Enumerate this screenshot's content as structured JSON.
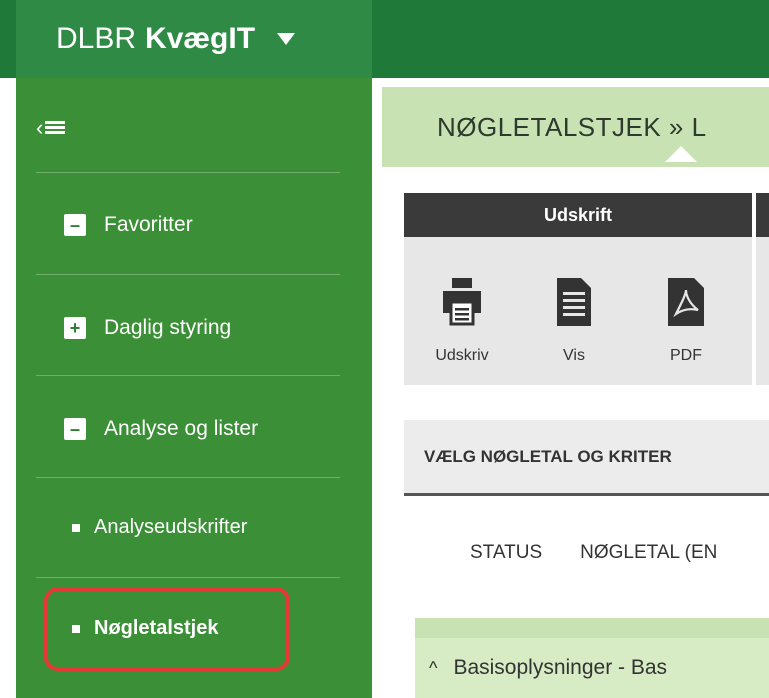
{
  "app": {
    "brand_part1": "DLBR",
    "brand_part2": "KvægIT"
  },
  "sidebar": {
    "items": [
      {
        "label": "Favoritter",
        "box": "–"
      },
      {
        "label": "Daglig styring",
        "box": "+"
      },
      {
        "label": "Analyse og lister",
        "box": "–"
      }
    ],
    "sub_items": [
      {
        "label": "Analyseudskrifter"
      },
      {
        "label": "Nøgletalstjek"
      }
    ]
  },
  "breadcrumb": {
    "text": "NØGLETALSTJEK » L"
  },
  "ribbon": {
    "group_label": "Udskrift",
    "buttons": [
      {
        "label": "Udskriv",
        "icon": "printer-icon"
      },
      {
        "label": "Vis",
        "icon": "document-icon"
      },
      {
        "label": "PDF",
        "icon": "pdf-icon"
      }
    ]
  },
  "tab": {
    "label": "VÆLG NØGLETAL OG KRITER"
  },
  "status_tabs": [
    "STATUS",
    "NØGLETAL (EN"
  ],
  "section": {
    "label": "Basisoplysninger - Bas"
  },
  "colors": {
    "sidebar": "#3b8f36",
    "topbar": "#1f7a3a",
    "breadcrumb": "#c9e2b3",
    "highlight": "#e53935"
  }
}
